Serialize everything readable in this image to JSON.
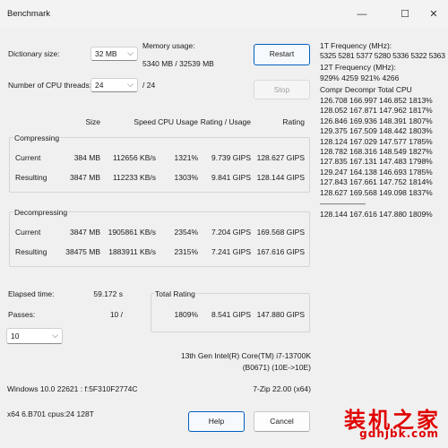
{
  "window": {
    "title": "Benchmark",
    "minimize_glyph": "—",
    "maximize_glyph": "☐",
    "close_glyph": "✕"
  },
  "settings": {
    "dict_label": "Dictionary size:",
    "dict_value": "32 MB",
    "threads_label": "Number of CPU threads:",
    "threads_value": "24",
    "threads_total": "/ 24",
    "memory_label": "Memory usage:",
    "memory_value": "5340 MB / 32539 MB"
  },
  "buttons": {
    "restart": "Restart",
    "stop": "Stop",
    "help": "Help",
    "cancel": "Cancel"
  },
  "table": {
    "headers": [
      "Size",
      "Speed",
      "CPU Usage",
      "Rating / Usage",
      "Rating"
    ],
    "compressing": {
      "label": "Compressing",
      "rows": [
        {
          "name": "Current",
          "size": "384 MB",
          "speed": "112656 KB/s",
          "cpu": "1321%",
          "rpu": "9.739 GIPS",
          "rating": "128.627 GIPS"
        },
        {
          "name": "Resulting",
          "size": "3847 MB",
          "speed": "112233 KB/s",
          "cpu": "1303%",
          "rpu": "9.841 GIPS",
          "rating": "128.144 GIPS"
        }
      ]
    },
    "decompressing": {
      "label": "Decompressing",
      "rows": [
        {
          "name": "Current",
          "size": "3847 MB",
          "speed": "1905861 KB/s",
          "cpu": "2354%",
          "rpu": "7.204 GIPS",
          "rating": "169.568 GIPS"
        },
        {
          "name": "Resulting",
          "size": "38475 MB",
          "speed": "1883911 KB/s",
          "cpu": "2315%",
          "rpu": "7.241 GIPS",
          "rating": "167.616 GIPS"
        }
      ]
    }
  },
  "stats": {
    "elapsed_label": "Elapsed time:",
    "elapsed_value": "59.172 s",
    "passes_label": "Passes:",
    "passes_value": "10 /",
    "passes_select": "10"
  },
  "total_rating": {
    "label": "Total Rating",
    "usage": "1809%",
    "rpu": "8.541 GIPS",
    "rating": "147.880 GIPS"
  },
  "cpu": {
    "name": "13th Gen Intel(R) Core(TM) i7-13700K",
    "id": "(B0671) (10E->10E)",
    "version": "7-Zip 22.00 (x64)"
  },
  "system": {
    "os": "Windows 10.0 22621 : f:5F310F2774C",
    "arch": "x64 6.B701 cpus:24 128T"
  },
  "freq": {
    "t1_label": "1T Frequency (MHz):",
    "t1_values": "5325 5281 5377 5280 5336 5322 5363",
    "t12_label": "12T Frequency (MHz):",
    "t12_values": "929% 4259 921% 4266",
    "header": "Compr Decompr Total   CPU",
    "lines": [
      "126.708  166.997  146.852  1813%",
      "128.052  167.871  147.962  1817%",
      "126.846  169.936  148.391  1807%",
      "129.375  167.509  148.442  1803%",
      "128.124  167.029  147.577  1785%",
      "128.782  168.316  148.549  1827%",
      "127.835  167.131  147.483  1798%",
      "129.247  164.138  146.693  1785%",
      "127.843  167.661  147.752  1814%",
      "128.627  169.568  149.098  1837%"
    ],
    "separator": "——————",
    "total": "128.144  167.616  147.880  1809%"
  },
  "watermark": {
    "cn": "装机之家",
    "url": "gdhjbk.com"
  }
}
